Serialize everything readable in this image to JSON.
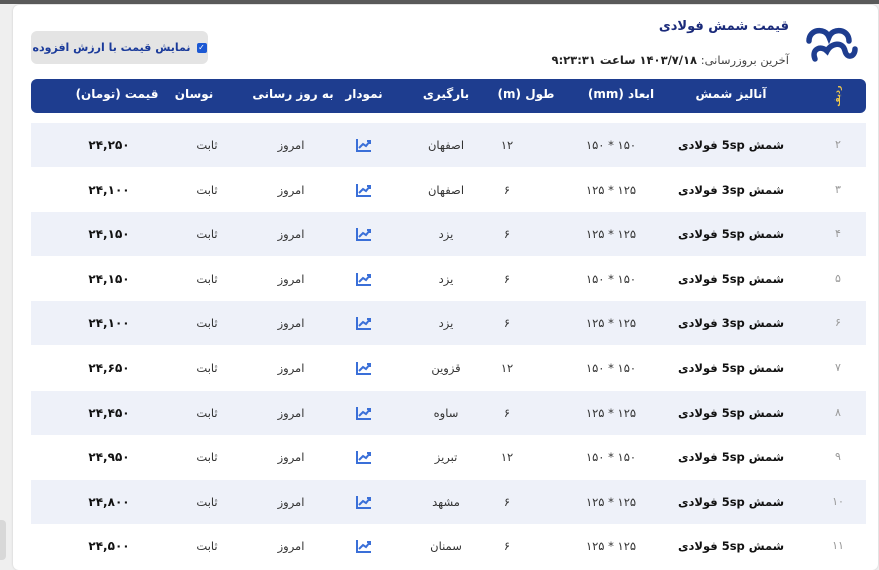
{
  "header": {
    "title": "قیمت شمش فولادی",
    "update_label": "آخرین بروزرسانی:",
    "update_value": "۱۴۰۳/۷/۱۸ ساعت ۹:۲۳:۳۱",
    "vat_label": "نمایش قیمت با ارزش افزوده",
    "vat_checked": true
  },
  "table": {
    "columns": [
      "ردیف",
      "آنالیز شمش",
      "ابعاد (mm)",
      "طول (m)",
      "بارگیری",
      "نمودار",
      "به روز رسانی",
      "نوسان",
      "قیمت (تومان)"
    ],
    "rows": [
      {
        "idx": "۲",
        "name": "شمش 5sp فولادی",
        "dims": "۱۵۰ * ۱۵۰",
        "length": "۱۲",
        "loading": "اصفهان",
        "updated": "امروز",
        "change": "ثابت",
        "price": "۲۴,۲۵۰"
      },
      {
        "idx": "۳",
        "name": "شمش 3sp فولادی",
        "dims": "۱۲۵ * ۱۲۵",
        "length": "۶",
        "loading": "اصفهان",
        "updated": "امروز",
        "change": "ثابت",
        "price": "۲۴,۱۰۰"
      },
      {
        "idx": "۴",
        "name": "شمش 5sp فولادی",
        "dims": "۱۲۵ * ۱۲۵",
        "length": "۶",
        "loading": "یزد",
        "updated": "امروز",
        "change": "ثابت",
        "price": "۲۴,۱۵۰"
      },
      {
        "idx": "۵",
        "name": "شمش 5sp فولادی",
        "dims": "۱۵۰ * ۱۵۰",
        "length": "۶",
        "loading": "یزد",
        "updated": "امروز",
        "change": "ثابت",
        "price": "۲۴,۱۵۰"
      },
      {
        "idx": "۶",
        "name": "شمش 3sp فولادی",
        "dims": "۱۲۵ * ۱۲۵",
        "length": "۶",
        "loading": "یزد",
        "updated": "امروز",
        "change": "ثابت",
        "price": "۲۴,۱۰۰"
      },
      {
        "idx": "۷",
        "name": "شمش 5sp فولادی",
        "dims": "۱۵۰ * ۱۵۰",
        "length": "۱۲",
        "loading": "قزوین",
        "updated": "امروز",
        "change": "ثابت",
        "price": "۲۴,۶۵۰"
      },
      {
        "idx": "۸",
        "name": "شمش 5sp فولادی",
        "dims": "۱۲۵ * ۱۲۵",
        "length": "۶",
        "loading": "ساوه",
        "updated": "امروز",
        "change": "ثابت",
        "price": "۲۴,۴۵۰"
      },
      {
        "idx": "۹",
        "name": "شمش 5sp فولادی",
        "dims": "۱۵۰ * ۱۵۰",
        "length": "۱۲",
        "loading": "تبریز",
        "updated": "امروز",
        "change": "ثابت",
        "price": "۲۴,۹۵۰"
      },
      {
        "idx": "۱۰",
        "name": "شمش 5sp فولادی",
        "dims": "۱۲۵ * ۱۲۵",
        "length": "۶",
        "loading": "مشهد",
        "updated": "امروز",
        "change": "ثابت",
        "price": "۲۴,۸۰۰"
      },
      {
        "idx": "۱۱",
        "name": "شمش 5sp فولادی",
        "dims": "۱۲۵ * ۱۲۵",
        "length": "۶",
        "loading": "سمنان",
        "updated": "امروز",
        "change": "ثابت",
        "price": "۲۴,۵۰۰"
      }
    ]
  },
  "colors": {
    "header_bg": "#1e3d8f",
    "shade_row": "#eef1f9",
    "chart_icon": "#3a6fd8",
    "radif": "#f2c94c"
  },
  "icons": {
    "chart": "chart-trend-icon",
    "logo": "brand-logo-icon",
    "checkbox": "checkbox-checked-icon"
  }
}
